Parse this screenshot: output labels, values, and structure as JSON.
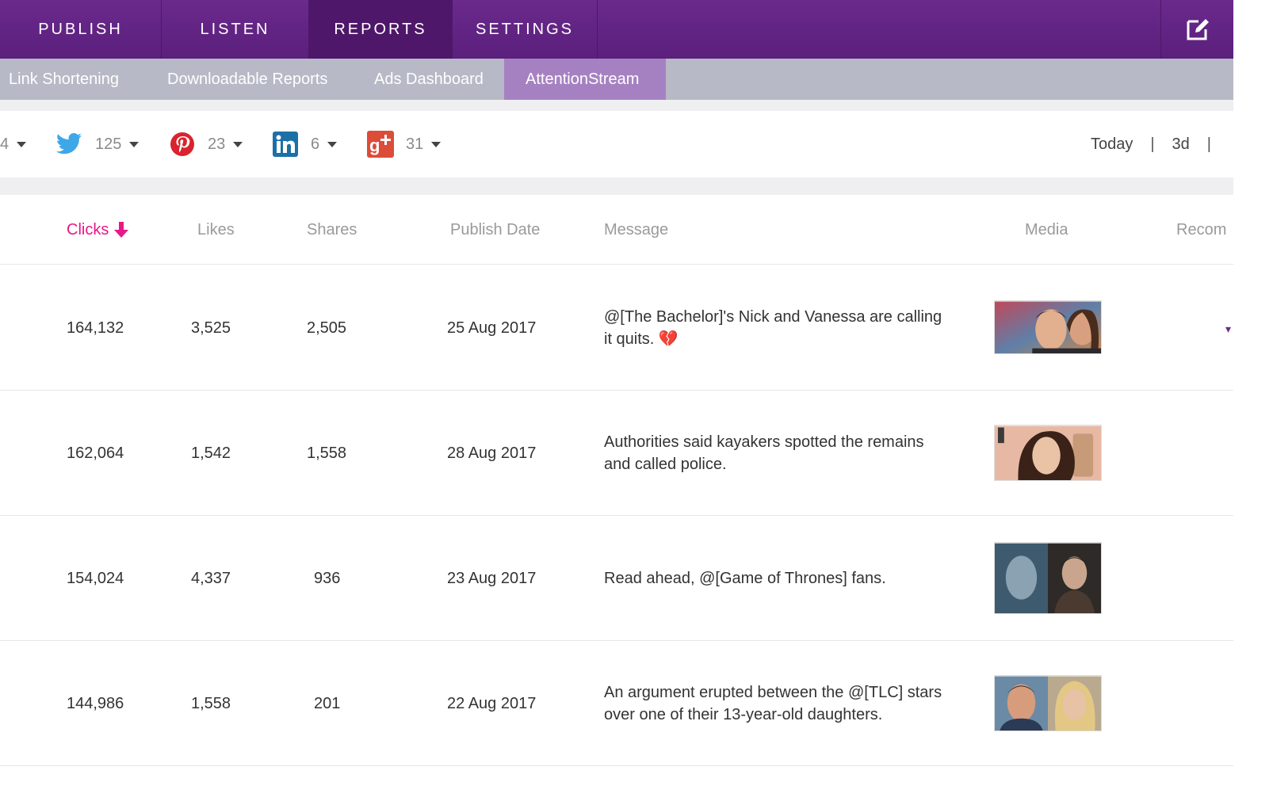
{
  "topnav": {
    "tabs": [
      {
        "label": "PUBLISH",
        "active": false
      },
      {
        "label": "LISTEN",
        "active": false
      },
      {
        "label": "REPORTS",
        "active": true
      },
      {
        "label": "SETTINGS",
        "active": false
      }
    ],
    "compose_icon": "compose-icon"
  },
  "subnav": {
    "items": [
      {
        "label": "Link Shortening",
        "active": false
      },
      {
        "label": "Downloadable Reports",
        "active": false
      },
      {
        "label": "Ads Dashboard",
        "active": false
      },
      {
        "label": "AttentionStream",
        "active": true
      }
    ]
  },
  "networks": [
    {
      "icon": "",
      "count": "4"
    },
    {
      "icon": "twitter-icon",
      "count": "125"
    },
    {
      "icon": "pinterest-icon",
      "count": "23"
    },
    {
      "icon": "linkedin-icon",
      "count": "6"
    },
    {
      "icon": "google-plus-icon",
      "count": "31"
    }
  ],
  "range": {
    "today": "Today",
    "d3": "3d",
    "sep": "|"
  },
  "table": {
    "headers": {
      "clicks": "Clicks",
      "likes": "Likes",
      "shares": "Shares",
      "publish_date": "Publish Date",
      "message": "Message",
      "media": "Media",
      "recom": "Recom"
    },
    "rows": [
      {
        "clicks": "164,132",
        "likes": "3,525",
        "shares": "2,505",
        "date": "25 Aug 2017",
        "message": "@[The Bachelor]'s Nick and Vanessa are calling it quits. 💔"
      },
      {
        "clicks": "162,064",
        "likes": "1,542",
        "shares": "1,558",
        "date": "28 Aug 2017",
        "message": "Authorities said kayakers spotted the remains and called police."
      },
      {
        "clicks": "154,024",
        "likes": "4,337",
        "shares": "936",
        "date": "23 Aug 2017",
        "message": "Read ahead, @[Game of Thrones] fans."
      },
      {
        "clicks": "144,986",
        "likes": "1,558",
        "shares": "201",
        "date": "22 Aug 2017",
        "message": "An argument erupted between the @[TLC] stars over one of their 13-year-old daughters."
      }
    ]
  },
  "colors": {
    "brand": "#5b1f7c",
    "accent": "#e8178a",
    "subnav_active": "#a681c2"
  }
}
